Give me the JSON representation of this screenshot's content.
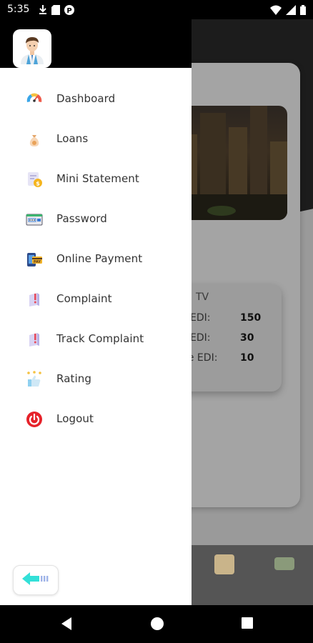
{
  "status_bar": {
    "time": "5:35",
    "left_icons": [
      "download-icon",
      "sd-card-icon",
      "app-notification-icon"
    ],
    "right_icons": [
      "wifi-icon",
      "signal-icon",
      "battery-icon"
    ]
  },
  "background_screen": {
    "card_title": "TV",
    "rows": [
      {
        "label": "EDI:",
        "value": "150"
      },
      {
        "label": "EDI:",
        "value": "30"
      },
      {
        "label": "ue EDI:",
        "value": "10"
      }
    ]
  },
  "drawer": {
    "avatar_icon": "doctor-avatar-icon",
    "menu": [
      {
        "label": "Dashboard",
        "icon": "speedometer-icon"
      },
      {
        "label": "Loans",
        "icon": "money-bag-icon"
      },
      {
        "label": "Mini Statement",
        "icon": "statement-icon"
      },
      {
        "label": "Password",
        "icon": "password-card-icon"
      },
      {
        "label": "Online Payment",
        "icon": "online-payment-icon"
      },
      {
        "label": "Complaint",
        "icon": "complaint-icon"
      },
      {
        "label": "Track Complaint",
        "icon": "track-complaint-icon"
      },
      {
        "label": "Rating",
        "icon": "rating-icon"
      },
      {
        "label": "Logout",
        "icon": "power-icon"
      }
    ],
    "back_icon": "back-arrow-icon",
    "accent": "#33e0d8"
  },
  "nav_bar": {
    "buttons": [
      "back-triangle-icon",
      "home-circle-icon",
      "recents-square-icon"
    ]
  }
}
